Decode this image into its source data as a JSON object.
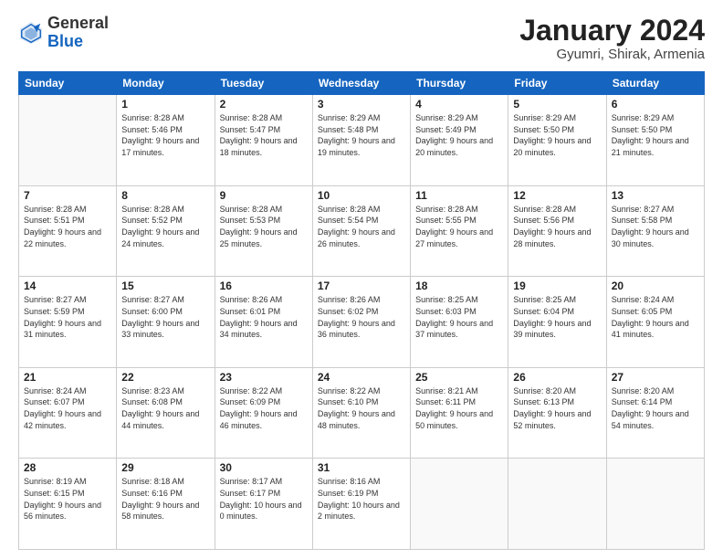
{
  "header": {
    "logo": {
      "general": "General",
      "blue": "Blue"
    },
    "title": "January 2024",
    "subtitle": "Gyumri, Shirak, Armenia"
  },
  "days_of_week": [
    "Sunday",
    "Monday",
    "Tuesday",
    "Wednesday",
    "Thursday",
    "Friday",
    "Saturday"
  ],
  "weeks": [
    [
      {
        "day": "",
        "sunrise": "",
        "sunset": "",
        "daylight": ""
      },
      {
        "day": "1",
        "sunrise": "Sunrise: 8:28 AM",
        "sunset": "Sunset: 5:46 PM",
        "daylight": "Daylight: 9 hours and 17 minutes."
      },
      {
        "day": "2",
        "sunrise": "Sunrise: 8:28 AM",
        "sunset": "Sunset: 5:47 PM",
        "daylight": "Daylight: 9 hours and 18 minutes."
      },
      {
        "day": "3",
        "sunrise": "Sunrise: 8:29 AM",
        "sunset": "Sunset: 5:48 PM",
        "daylight": "Daylight: 9 hours and 19 minutes."
      },
      {
        "day": "4",
        "sunrise": "Sunrise: 8:29 AM",
        "sunset": "Sunset: 5:49 PM",
        "daylight": "Daylight: 9 hours and 20 minutes."
      },
      {
        "day": "5",
        "sunrise": "Sunrise: 8:29 AM",
        "sunset": "Sunset: 5:50 PM",
        "daylight": "Daylight: 9 hours and 20 minutes."
      },
      {
        "day": "6",
        "sunrise": "Sunrise: 8:29 AM",
        "sunset": "Sunset: 5:50 PM",
        "daylight": "Daylight: 9 hours and 21 minutes."
      }
    ],
    [
      {
        "day": "7",
        "sunrise": "Sunrise: 8:28 AM",
        "sunset": "Sunset: 5:51 PM",
        "daylight": "Daylight: 9 hours and 22 minutes."
      },
      {
        "day": "8",
        "sunrise": "Sunrise: 8:28 AM",
        "sunset": "Sunset: 5:52 PM",
        "daylight": "Daylight: 9 hours and 24 minutes."
      },
      {
        "day": "9",
        "sunrise": "Sunrise: 8:28 AM",
        "sunset": "Sunset: 5:53 PM",
        "daylight": "Daylight: 9 hours and 25 minutes."
      },
      {
        "day": "10",
        "sunrise": "Sunrise: 8:28 AM",
        "sunset": "Sunset: 5:54 PM",
        "daylight": "Daylight: 9 hours and 26 minutes."
      },
      {
        "day": "11",
        "sunrise": "Sunrise: 8:28 AM",
        "sunset": "Sunset: 5:55 PM",
        "daylight": "Daylight: 9 hours and 27 minutes."
      },
      {
        "day": "12",
        "sunrise": "Sunrise: 8:28 AM",
        "sunset": "Sunset: 5:56 PM",
        "daylight": "Daylight: 9 hours and 28 minutes."
      },
      {
        "day": "13",
        "sunrise": "Sunrise: 8:27 AM",
        "sunset": "Sunset: 5:58 PM",
        "daylight": "Daylight: 9 hours and 30 minutes."
      }
    ],
    [
      {
        "day": "14",
        "sunrise": "Sunrise: 8:27 AM",
        "sunset": "Sunset: 5:59 PM",
        "daylight": "Daylight: 9 hours and 31 minutes."
      },
      {
        "day": "15",
        "sunrise": "Sunrise: 8:27 AM",
        "sunset": "Sunset: 6:00 PM",
        "daylight": "Daylight: 9 hours and 33 minutes."
      },
      {
        "day": "16",
        "sunrise": "Sunrise: 8:26 AM",
        "sunset": "Sunset: 6:01 PM",
        "daylight": "Daylight: 9 hours and 34 minutes."
      },
      {
        "day": "17",
        "sunrise": "Sunrise: 8:26 AM",
        "sunset": "Sunset: 6:02 PM",
        "daylight": "Daylight: 9 hours and 36 minutes."
      },
      {
        "day": "18",
        "sunrise": "Sunrise: 8:25 AM",
        "sunset": "Sunset: 6:03 PM",
        "daylight": "Daylight: 9 hours and 37 minutes."
      },
      {
        "day": "19",
        "sunrise": "Sunrise: 8:25 AM",
        "sunset": "Sunset: 6:04 PM",
        "daylight": "Daylight: 9 hours and 39 minutes."
      },
      {
        "day": "20",
        "sunrise": "Sunrise: 8:24 AM",
        "sunset": "Sunset: 6:05 PM",
        "daylight": "Daylight: 9 hours and 41 minutes."
      }
    ],
    [
      {
        "day": "21",
        "sunrise": "Sunrise: 8:24 AM",
        "sunset": "Sunset: 6:07 PM",
        "daylight": "Daylight: 9 hours and 42 minutes."
      },
      {
        "day": "22",
        "sunrise": "Sunrise: 8:23 AM",
        "sunset": "Sunset: 6:08 PM",
        "daylight": "Daylight: 9 hours and 44 minutes."
      },
      {
        "day": "23",
        "sunrise": "Sunrise: 8:22 AM",
        "sunset": "Sunset: 6:09 PM",
        "daylight": "Daylight: 9 hours and 46 minutes."
      },
      {
        "day": "24",
        "sunrise": "Sunrise: 8:22 AM",
        "sunset": "Sunset: 6:10 PM",
        "daylight": "Daylight: 9 hours and 48 minutes."
      },
      {
        "day": "25",
        "sunrise": "Sunrise: 8:21 AM",
        "sunset": "Sunset: 6:11 PM",
        "daylight": "Daylight: 9 hours and 50 minutes."
      },
      {
        "day": "26",
        "sunrise": "Sunrise: 8:20 AM",
        "sunset": "Sunset: 6:13 PM",
        "daylight": "Daylight: 9 hours and 52 minutes."
      },
      {
        "day": "27",
        "sunrise": "Sunrise: 8:20 AM",
        "sunset": "Sunset: 6:14 PM",
        "daylight": "Daylight: 9 hours and 54 minutes."
      }
    ],
    [
      {
        "day": "28",
        "sunrise": "Sunrise: 8:19 AM",
        "sunset": "Sunset: 6:15 PM",
        "daylight": "Daylight: 9 hours and 56 minutes."
      },
      {
        "day": "29",
        "sunrise": "Sunrise: 8:18 AM",
        "sunset": "Sunset: 6:16 PM",
        "daylight": "Daylight: 9 hours and 58 minutes."
      },
      {
        "day": "30",
        "sunrise": "Sunrise: 8:17 AM",
        "sunset": "Sunset: 6:17 PM",
        "daylight": "Daylight: 10 hours and 0 minutes."
      },
      {
        "day": "31",
        "sunrise": "Sunrise: 8:16 AM",
        "sunset": "Sunset: 6:19 PM",
        "daylight": "Daylight: 10 hours and 2 minutes."
      },
      {
        "day": "",
        "sunrise": "",
        "sunset": "",
        "daylight": ""
      },
      {
        "day": "",
        "sunrise": "",
        "sunset": "",
        "daylight": ""
      },
      {
        "day": "",
        "sunrise": "",
        "sunset": "",
        "daylight": ""
      }
    ]
  ]
}
